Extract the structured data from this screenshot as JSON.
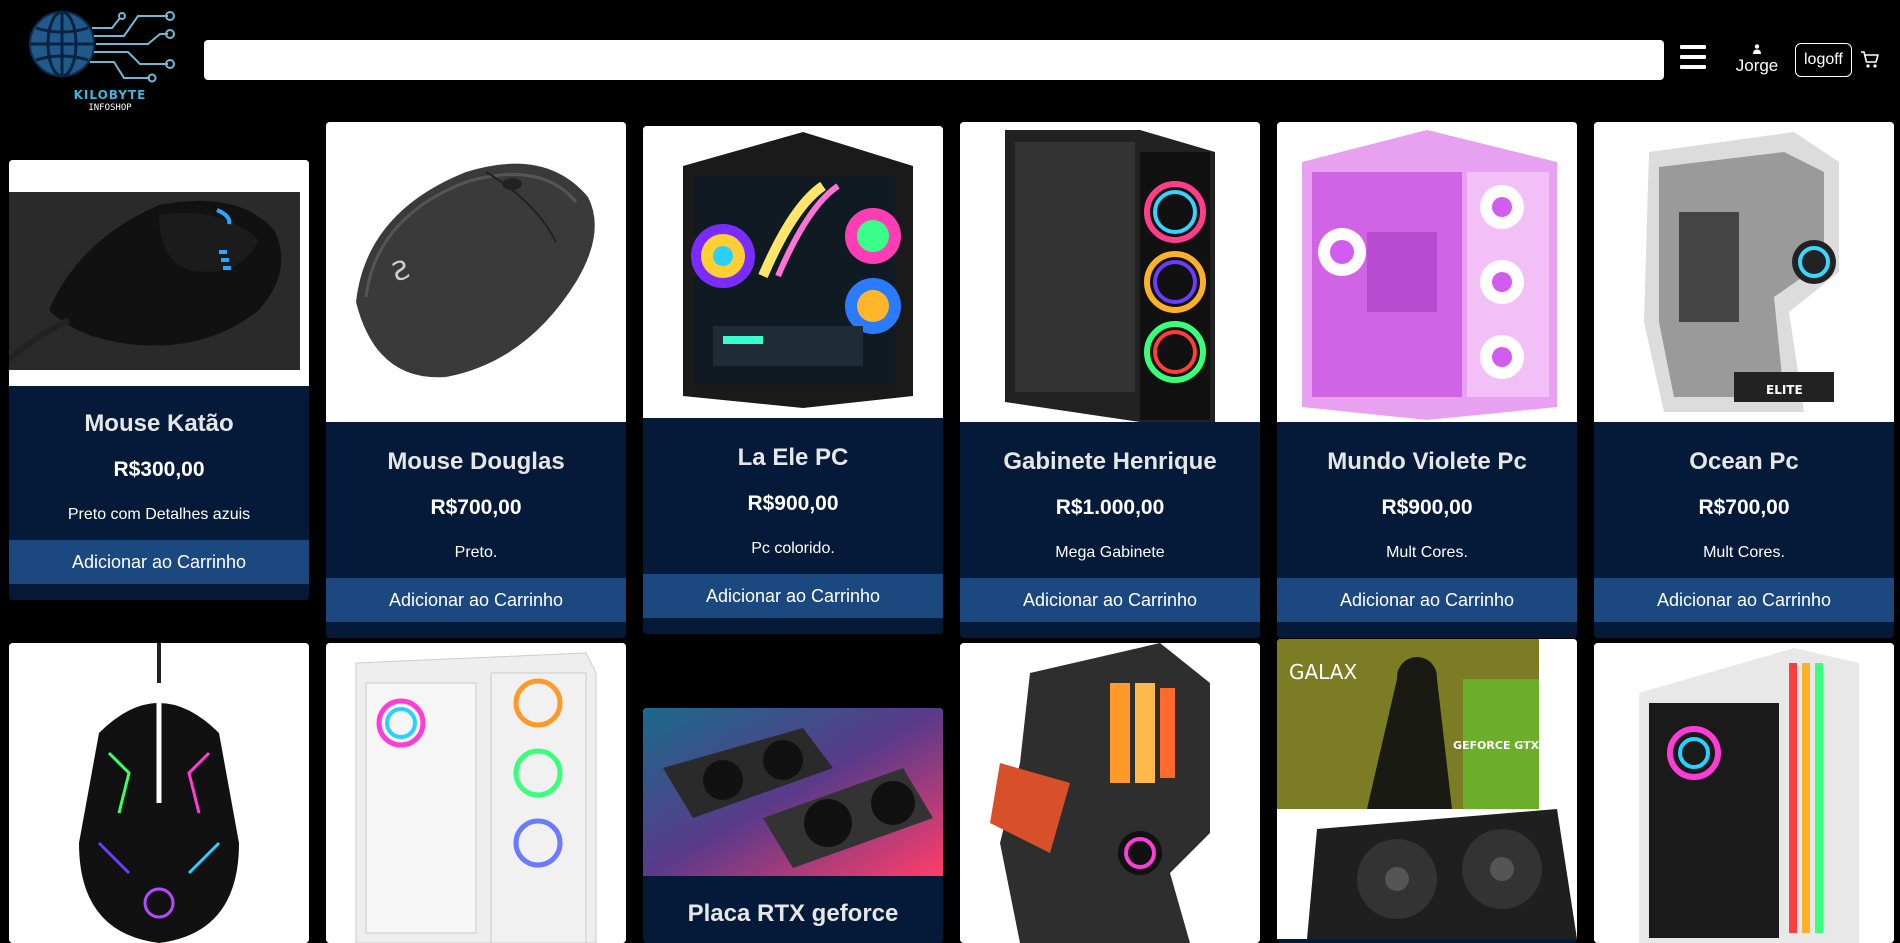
{
  "brand": {
    "name": "KILOBYTE",
    "subtitle": "INFOSHOP",
    "logo_icon": "globe-circuit-icon",
    "accent": "#1f5a8a"
  },
  "header": {
    "search": {
      "value": "",
      "placeholder": ""
    },
    "menu_icon": "hamburger-menu-icon",
    "user": {
      "icon": "user-icon",
      "name": "Jorge"
    },
    "logoff_label": "logoff",
    "cart_icon": "cart-icon"
  },
  "colors": {
    "background": "#000000",
    "card": "#041a38",
    "button": "#1c4880"
  },
  "products": [
    {
      "name": "Mouse Katão",
      "price": "R$300,00",
      "description": "Preto com Detalhes azuis",
      "button_label": "Adicionar ao Carrinho",
      "image": "black-gaming-mouse"
    },
    {
      "name": "Mouse Douglas",
      "price": "R$700,00",
      "description": "Preto.",
      "button_label": "Adicionar ao Carrinho",
      "image": "grey-wireless-mouse"
    },
    {
      "name": "La Ele PC",
      "price": "R$900,00",
      "description": "Pc colorido.",
      "button_label": "Adicionar ao Carrinho",
      "image": "rgb-glass-pc"
    },
    {
      "name": "Gabinete Henrique",
      "price": "R$1.000,00",
      "description": "Mega Gabinete",
      "button_label": "Adicionar ao Carrinho",
      "image": "black-rgb-case"
    },
    {
      "name": "Mundo Violete Pc",
      "price": "R$900,00",
      "description": "Mult Cores.",
      "button_label": "Adicionar ao Carrinho",
      "image": "pink-pc"
    },
    {
      "name": "Ocean Pc",
      "price": "R$700,00",
      "description": "Mult Cores.",
      "button_label": "Adicionar ao Carrinho",
      "image": "white-open-case"
    },
    {
      "name": "",
      "price": "",
      "description": "",
      "button_label": "",
      "image": "rgb-gaming-mouse"
    },
    {
      "name": "",
      "price": "",
      "description": "",
      "button_label": "",
      "image": "white-rgb-case"
    },
    {
      "name": "Placa RTX geforce",
      "price": "",
      "description": "",
      "button_label": "",
      "image": "rtx-graphics-cards"
    },
    {
      "name": "",
      "price": "",
      "description": "",
      "button_label": "",
      "image": "black-orange-case"
    },
    {
      "name": "",
      "price": "",
      "description": "",
      "button_label": "",
      "image": "galax-gtx-box"
    },
    {
      "name": "",
      "price": "",
      "description": "",
      "button_label": "",
      "image": "white-rgb-tower"
    }
  ],
  "galax_box": {
    "brand": "GALAX",
    "product": "GEFORCE GTX"
  }
}
